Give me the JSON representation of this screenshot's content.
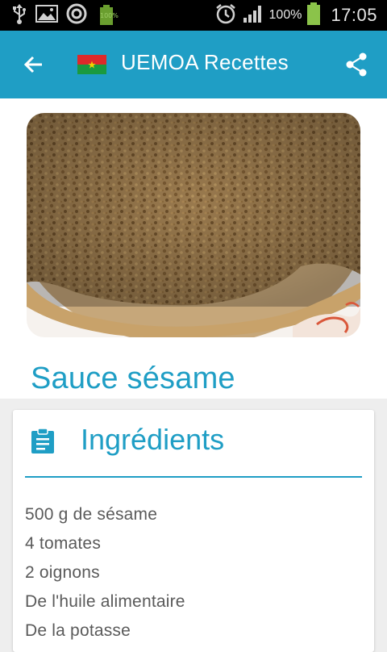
{
  "status_bar": {
    "battery_small_label": "100%",
    "battery_percent": "100%",
    "time": "17:05",
    "icons": [
      "usb-icon",
      "image-icon",
      "sync-icon",
      "battery-icon",
      "alarm-icon",
      "signal-icon"
    ]
  },
  "app_bar": {
    "title": "UEMOA Recettes",
    "flag": "burkina-faso-flag",
    "color": "#1f9ec5"
  },
  "recipe": {
    "title": "Sauce sésame"
  },
  "ingredients": {
    "heading": "Ingrédients",
    "items": [
      "500 g de sésame",
      "4 tomates",
      "2 oignons",
      "De l'huile alimentaire",
      "De la potasse"
    ]
  }
}
